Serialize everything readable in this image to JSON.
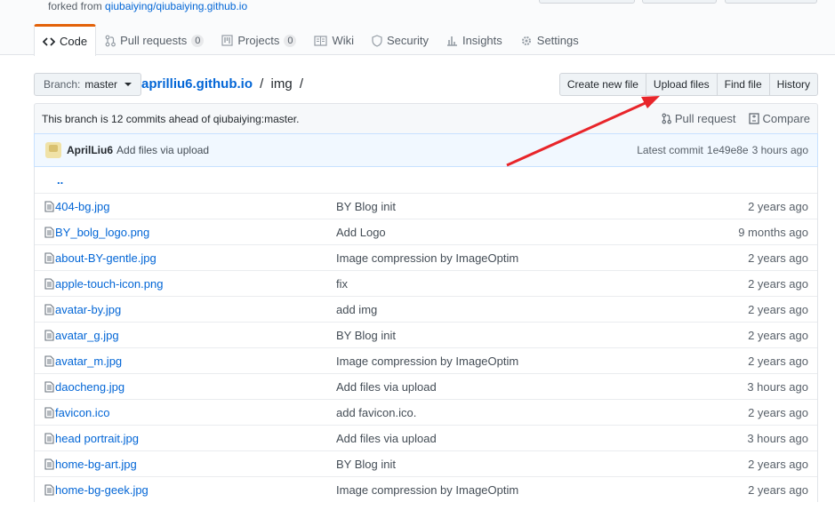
{
  "repohead": {
    "forked_prefix": "forked from",
    "forked_link": "qiubaiying/qiubaiying.github.io"
  },
  "tabs": [
    {
      "label": "Code",
      "icon": "code-icon",
      "selected": true
    },
    {
      "label": "Pull requests",
      "icon": "git-pull-request-icon",
      "counter": "0"
    },
    {
      "label": "Projects",
      "icon": "project-icon",
      "counter": "0"
    },
    {
      "label": "Wiki",
      "icon": "book-icon"
    },
    {
      "label": "Security",
      "icon": "shield-icon"
    },
    {
      "label": "Insights",
      "icon": "graph-icon"
    },
    {
      "label": "Settings",
      "icon": "gear-icon"
    }
  ],
  "branch": {
    "prefix": "Branch:",
    "name": "master"
  },
  "breadcrumb": {
    "repo": "aprilliu6.github.io",
    "sep1": "/",
    "dir": "img",
    "sep2": "/"
  },
  "file_nav": {
    "create": "Create new file",
    "upload": "Upload files",
    "find": "Find file",
    "history": "History"
  },
  "branch_info": {
    "text": "This branch is 12 commits ahead of qiubaiying:master.",
    "pull_request": "Pull request",
    "compare": "Compare"
  },
  "commit": {
    "author": "AprilLiu6",
    "message": "Add files via upload",
    "latest_label": "Latest commit",
    "sha": "1e49e8e",
    "age": "3 hours ago"
  },
  "up_dir": "..",
  "files": [
    {
      "name": "404-bg.jpg",
      "message": "BY Blog init",
      "age": "2 years ago"
    },
    {
      "name": "BY_bolg_logo.png",
      "message": "Add Logo",
      "age": "9 months ago"
    },
    {
      "name": "about-BY-gentle.jpg",
      "message": "Image compression by ImageOptim",
      "age": "2 years ago"
    },
    {
      "name": "apple-touch-icon.png",
      "message": "fix",
      "age": "2 years ago"
    },
    {
      "name": "avatar-by.jpg",
      "message": "add img",
      "age": "2 years ago"
    },
    {
      "name": "avatar_g.jpg",
      "message": "BY Blog init",
      "age": "2 years ago"
    },
    {
      "name": "avatar_m.jpg",
      "message": "Image compression by ImageOptim",
      "age": "2 years ago"
    },
    {
      "name": "daocheng.jpg",
      "message": "Add files via upload",
      "age": "3 hours ago"
    },
    {
      "name": "favicon.ico",
      "message": "add favicon.ico.",
      "age": "2 years ago"
    },
    {
      "name": "head portrait.jpg",
      "message": "Add files via upload",
      "age": "3 hours ago"
    },
    {
      "name": "home-bg-art.jpg",
      "message": "BY Blog init",
      "age": "2 years ago"
    },
    {
      "name": "home-bg-geek.jpg",
      "message": "Image compression by ImageOptim",
      "age": "2 years ago"
    }
  ],
  "colors": {
    "link": "#0366d6",
    "tab_accent": "#e36209",
    "annotation_arrow": "#e8252a"
  }
}
